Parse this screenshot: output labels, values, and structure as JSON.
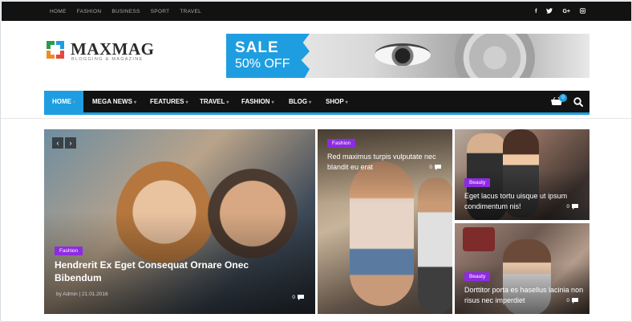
{
  "topbar": {
    "links": [
      "HOME",
      "FASHION",
      "BUSINESS",
      "SPORT",
      "TRAVEL"
    ],
    "social": [
      "f",
      "t",
      "G+",
      "ig"
    ]
  },
  "logo": {
    "name": "MAXMAG",
    "tagline": "BLOGGING & MAGAZINE"
  },
  "banner": {
    "line1": "SALE",
    "line2": "50% OFF"
  },
  "nav": {
    "items": [
      "HOME",
      "MEGA NEWS",
      "FEATURES",
      "TRAVEL",
      "FASHION",
      "BLOG",
      "SHOP"
    ],
    "cart_count": "0"
  },
  "tiles": {
    "main": {
      "category": "Fashion",
      "title": "Hendrerit Ex Eget Consequat Ornare Onec Bibendum",
      "meta": "by Admin | 21.01.2016",
      "comments": "0"
    },
    "second": {
      "category": "Fashion",
      "title": "Red maximus turpis vulputate nec blandit eu erat",
      "comments": "0"
    },
    "third": {
      "category": "Beauty",
      "title": "Eget lacus tortu uisque ut ipsum condimentum nis!",
      "comments": "0"
    },
    "fourth": {
      "category": "Beauty",
      "title": "Dorttitor porta es hasellus lacinia non risus nec imperdiet",
      "comments": "0"
    }
  },
  "colors": {
    "accent": "#1e9ee0",
    "badge": "#8e2be2",
    "bar": "#121212"
  }
}
